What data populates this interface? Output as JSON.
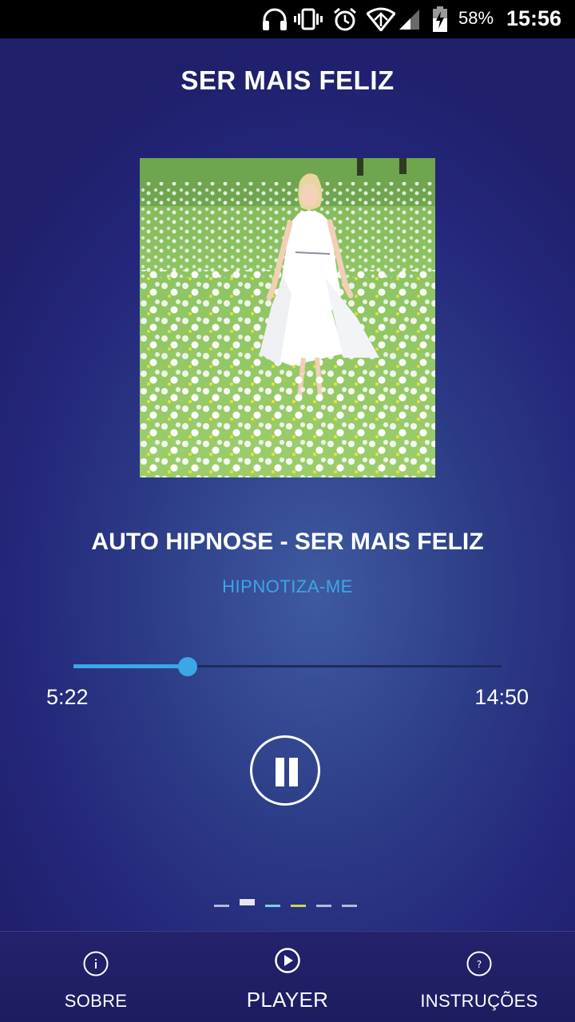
{
  "status_bar": {
    "battery_percent": "58%",
    "time": "15:56",
    "icons": [
      "headphones-icon",
      "vibrate-icon",
      "alarm-icon",
      "wifi-icon",
      "signal-icon",
      "battery-charging-icon"
    ]
  },
  "screen": {
    "title": "SER MAIS FELIZ"
  },
  "player": {
    "track_title": "AUTO HIPNOSE - SER MAIS FELIZ",
    "artist": "HIPNOTIZA-ME",
    "elapsed": "5:22",
    "total": "14:50",
    "progress_fraction": 0.266,
    "state": "playing",
    "control_icon": "pause-icon"
  },
  "page_indicator": {
    "count": 6,
    "colors": [
      "#b8b8d8",
      "#e6e6f2",
      "#7ad0e0",
      "#c8d85a",
      "#b8b8d8",
      "#b8b8d8"
    ]
  },
  "bottom_nav": {
    "items": [
      {
        "label": "SOBRE",
        "icon": "info-icon",
        "active": false
      },
      {
        "label": "PLAYER",
        "icon": "play-circle-icon",
        "active": true
      },
      {
        "label": "INSTRUÇÕES",
        "icon": "help-icon",
        "active": false
      }
    ]
  },
  "colors": {
    "accent": "#3aa8e6",
    "background": "#2c3a86",
    "status_bar": "#000000"
  }
}
